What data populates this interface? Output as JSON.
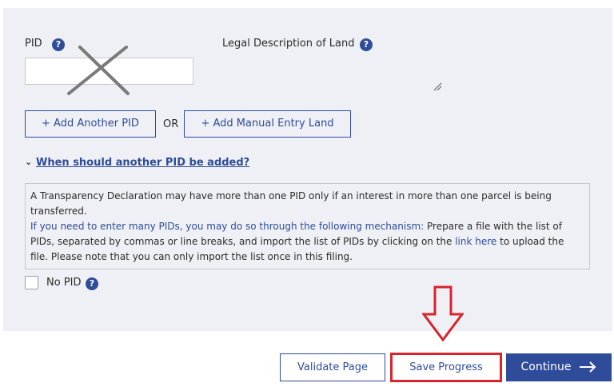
{
  "form": {
    "pid_label": "PID",
    "help_icon_text": "?",
    "pid_value": "",
    "legal_description_label": "Legal Description of Land",
    "add_pid_button": "+ Add Another PID",
    "or_text": "OR",
    "add_manual_button": "+ Add Manual Entry Land",
    "faq_link": "When should another PID be added?",
    "info": {
      "line1": "A Transparency Declaration may have more than one PID only if an interest in more than one parcel is being transferred.",
      "line2_blue": "If you need to enter many PIDs, you may do so through the following mechanism:",
      "line2_rest": " Prepare a file with the list of PIDs, separated by commas or line breaks, and import the list of PIDs by clicking on the ",
      "link_text": "link here",
      "line2_end": " to upload the file. Please note that you can only import the list once in this filing."
    },
    "no_pid_label": "No PID",
    "no_pid_checked": false
  },
  "footer": {
    "validate_label": "Validate Page",
    "save_label": "Save Progress",
    "continue_label": "Continue"
  },
  "colors": {
    "brand_blue": "#2e4c9a",
    "highlight_red": "#d9232e",
    "panel_bg": "#eef0f5"
  },
  "icons": [
    "help-icon",
    "chevron-down-icon",
    "arrow-right-icon",
    "resize-handle-icon",
    "down-arrow-annotation-icon",
    "x-mark-annotation-icon"
  ]
}
